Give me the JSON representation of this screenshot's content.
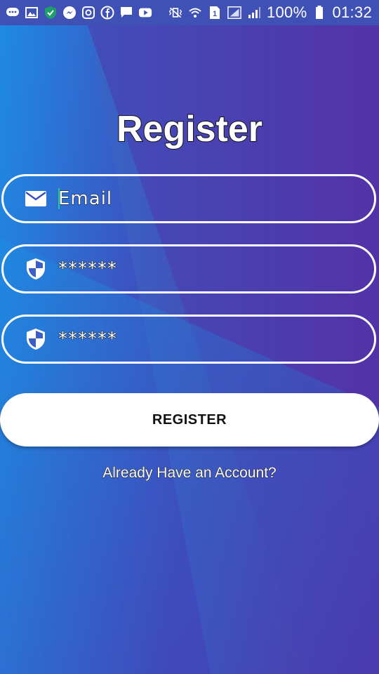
{
  "status_bar": {
    "battery": "100%",
    "time": "01:32",
    "left_icons": [
      "chat-bubble-icon",
      "gallery-icon",
      "shield-check-icon",
      "messenger-icon",
      "instagram-icon",
      "facebook-icon",
      "message-icon",
      "youtube-icon"
    ],
    "right_icons": [
      "vibrate-icon",
      "wifi-icon",
      "sim-icon",
      "signal-icon",
      "battery-icon"
    ]
  },
  "page": {
    "title": "Register",
    "background_colors": [
      "#1e88e5",
      "#5e2a9b"
    ]
  },
  "form": {
    "email": {
      "value": "Email",
      "icon": "mail-icon"
    },
    "password": {
      "value": "******",
      "icon": "shield-icon"
    },
    "confirm_password": {
      "value": "******",
      "icon": "shield-icon"
    },
    "register_button": "REGISTER",
    "login_link": "Already Have an Account?"
  }
}
